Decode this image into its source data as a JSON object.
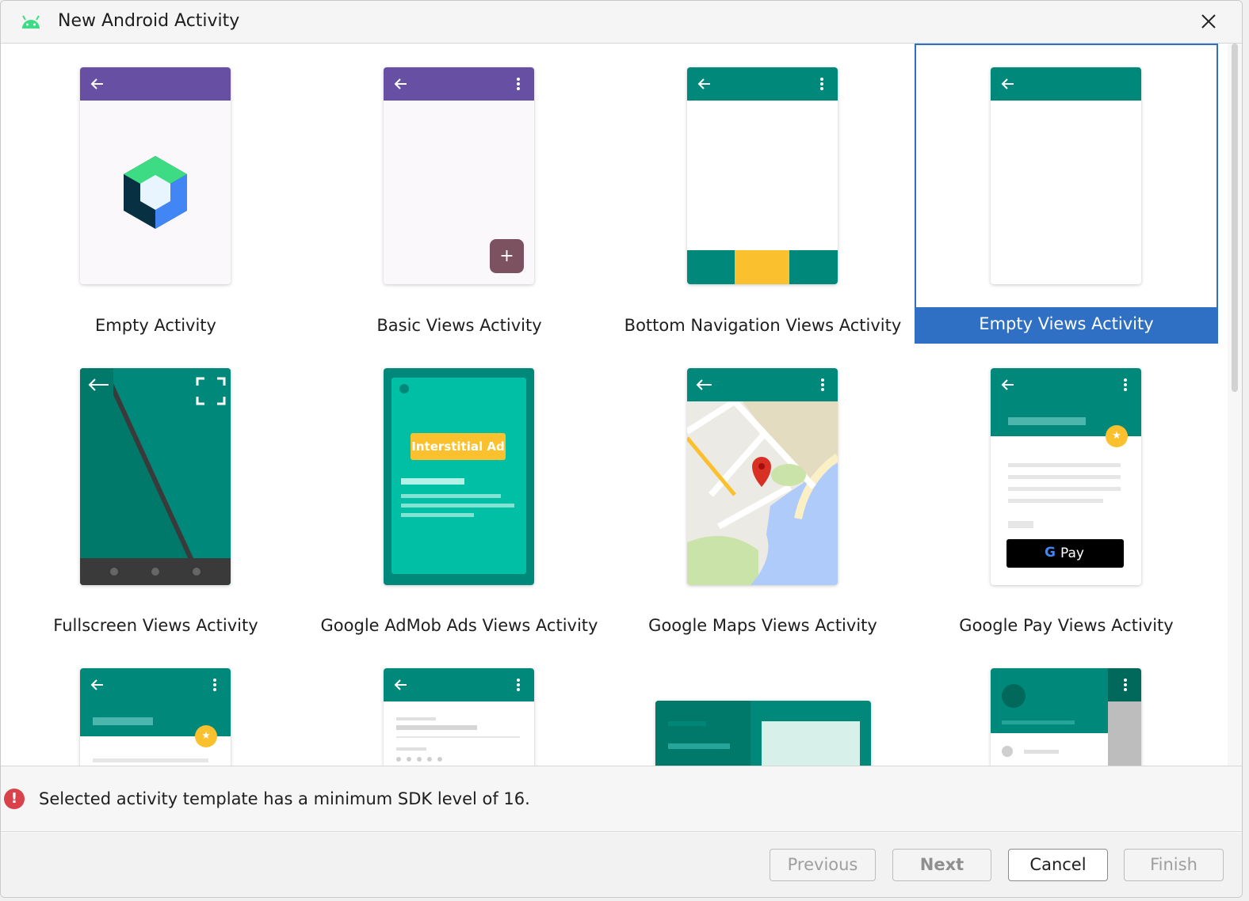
{
  "window": {
    "title": "New Android Activity"
  },
  "templates": [
    {
      "label": "Empty Activity",
      "selected": false
    },
    {
      "label": "Basic Views Activity",
      "selected": false
    },
    {
      "label": "Bottom Navigation Views Activity",
      "selected": false
    },
    {
      "label": "Empty Views Activity",
      "selected": true
    },
    {
      "label": "Fullscreen Views Activity",
      "selected": false
    },
    {
      "label": "Google AdMob Ads Views Activity",
      "selected": false,
      "badge": "Interstitial Ad"
    },
    {
      "label": "Google Maps Views Activity",
      "selected": false
    },
    {
      "label": "Google Pay Views Activity",
      "selected": false,
      "badge": "Pay"
    }
  ],
  "status": {
    "message": "Selected activity template has a minimum SDK level of 16.",
    "icon": "error-icon",
    "color": "#d9424b"
  },
  "buttons": {
    "previous": "Previous",
    "next": "Next",
    "cancel": "Cancel",
    "finish": "Finish"
  },
  "colors": {
    "purple": "#6750a4",
    "teal": "#00897b",
    "selection": "#2f6fc4",
    "amber": "#fbc02d"
  }
}
